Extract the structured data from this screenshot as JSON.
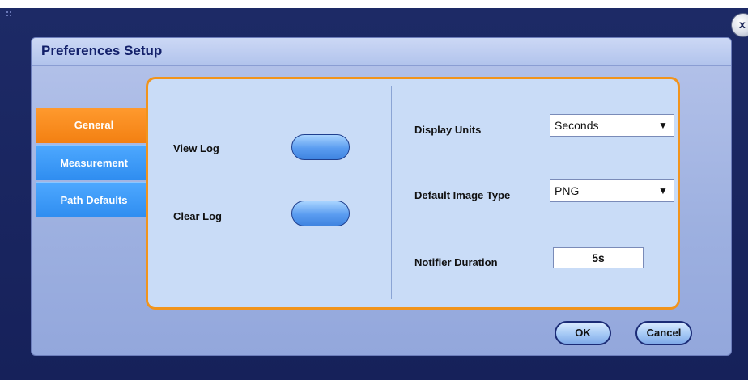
{
  "dialog": {
    "title": "Preferences Setup",
    "close_label": "x"
  },
  "tabs": [
    {
      "label": "General",
      "active": true
    },
    {
      "label": "Measurement",
      "active": false
    },
    {
      "label": "Path Defaults",
      "active": false
    }
  ],
  "general": {
    "view_log_label": "View Log",
    "clear_log_label": "Clear Log",
    "display_units_label": "Display Units",
    "display_units_value": "Seconds",
    "default_image_type_label": "Default Image Type",
    "default_image_type_value": "PNG",
    "notifier_duration_label": "Notifier Duration",
    "notifier_duration_value": "5s"
  },
  "footer": {
    "ok_label": "OK",
    "cancel_label": "Cancel"
  },
  "colors": {
    "accent_orange": "#f1941c",
    "tab_blue": "#2f8df0",
    "title_text": "#13206a"
  },
  "icons": {
    "close": "close-icon",
    "dropdown": "dropdown-arrow-icon",
    "grip": "grip-icon"
  }
}
